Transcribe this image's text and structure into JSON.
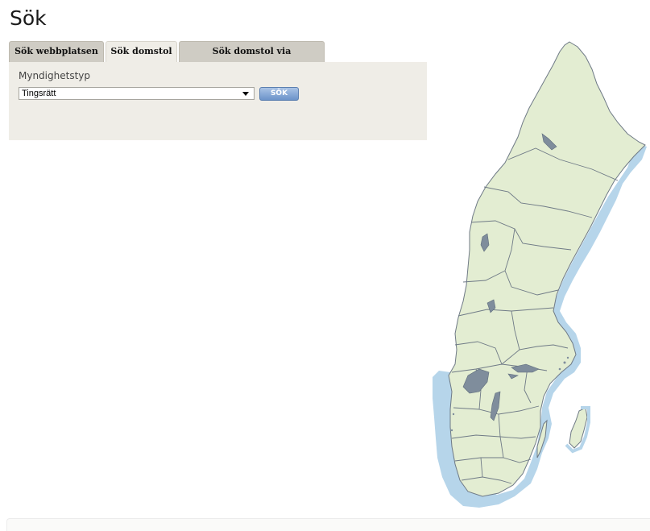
{
  "page": {
    "title": "Sök"
  },
  "tabs": [
    {
      "label": "Sök webbplatsen",
      "active": false
    },
    {
      "label": "Sök domstol",
      "active": true
    },
    {
      "label": "Sök domstol via postnummer",
      "active": false
    }
  ],
  "form": {
    "field_label": "Myndighetstyp",
    "selected_value": "Tingsrätt",
    "button_label": "SÖK"
  },
  "colors": {
    "land": "#e3edd2",
    "sea": "#b6d5ea",
    "border": "#6f7a86",
    "lakes": "#7f8d9c",
    "button": "#6c93c9",
    "panel": "#efede7"
  }
}
